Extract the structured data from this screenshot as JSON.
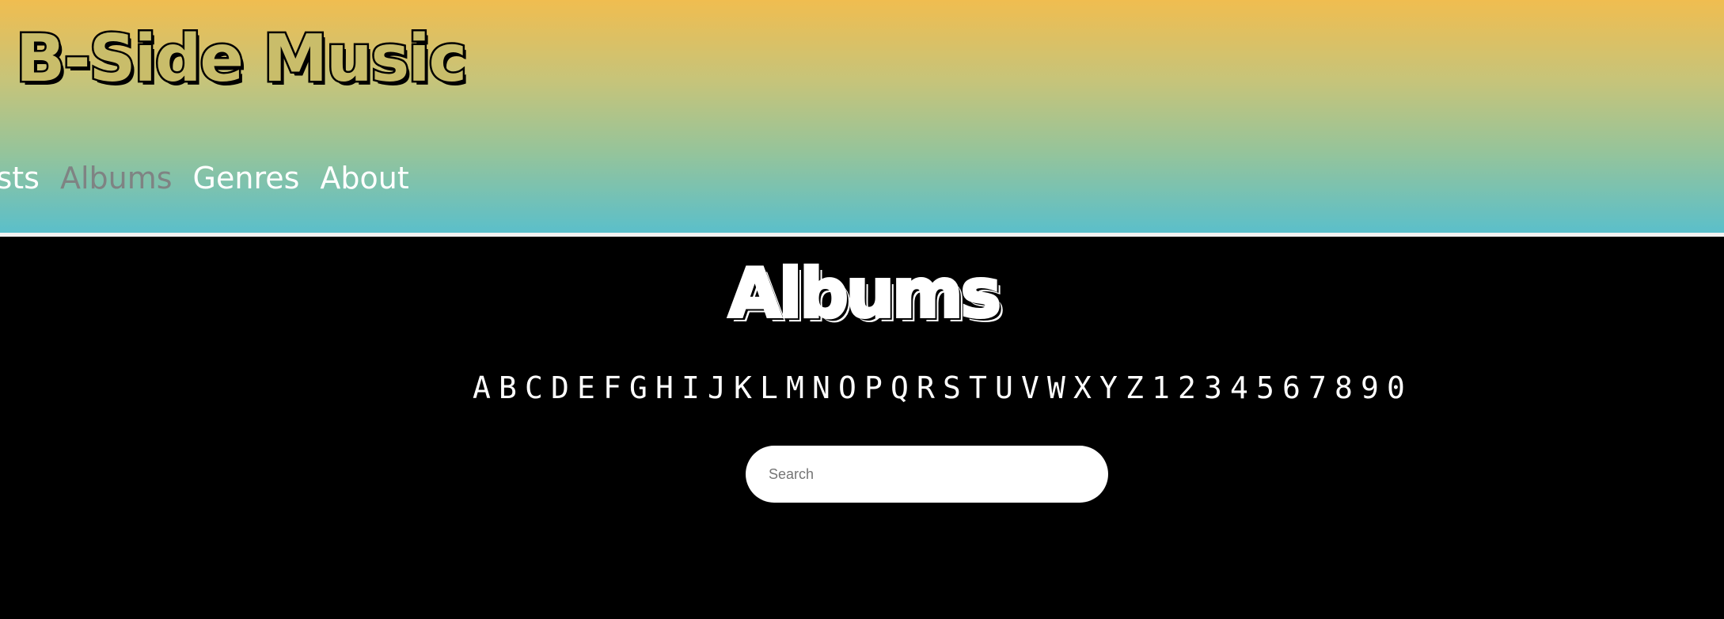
{
  "header": {
    "site_title": "B-Side Music",
    "nav": [
      {
        "label": "tists",
        "active": false
      },
      {
        "label": "Albums",
        "active": true
      },
      {
        "label": "Genres",
        "active": false
      },
      {
        "label": "About",
        "active": false
      }
    ]
  },
  "main": {
    "heading": "Albums",
    "index_letters": [
      "A",
      "B",
      "C",
      "D",
      "E",
      "F",
      "G",
      "H",
      "I",
      "J",
      "K",
      "L",
      "M",
      "N",
      "O",
      "P",
      "Q",
      "R",
      "S",
      "T",
      "U",
      "V",
      "W",
      "X",
      "Y",
      "Z",
      "1",
      "2",
      "3",
      "4",
      "5",
      "6",
      "7",
      "8",
      "9",
      "0"
    ],
    "search": {
      "placeholder": "Search",
      "value": ""
    }
  },
  "colors": {
    "header_gradient_top": "#f0bd50",
    "header_gradient_bottom": "#5bbfca",
    "active_nav": "#7f8383",
    "background": "#000000"
  }
}
